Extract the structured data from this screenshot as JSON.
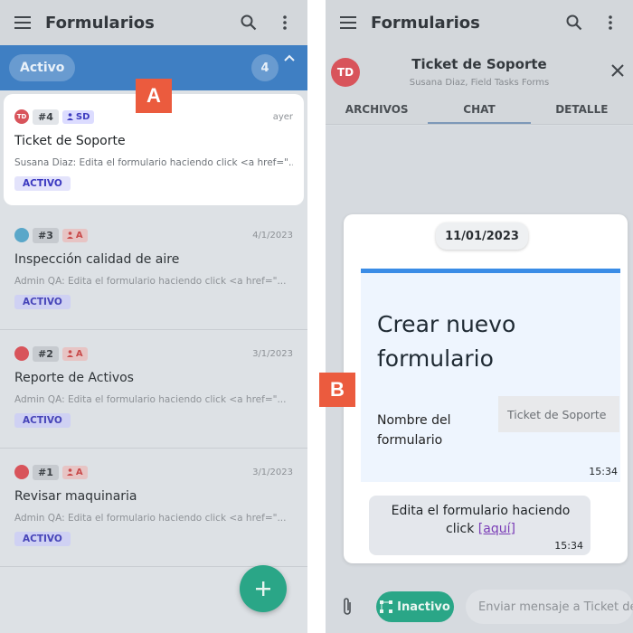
{
  "left_panel": {
    "app_title": "Formularios",
    "section": {
      "label": "Activo",
      "count": "4"
    },
    "tickets": [
      {
        "avatar": "TD",
        "avatar_color": "#d8545b",
        "number": "#4",
        "user": "SD",
        "date": "ayer",
        "title": "Ticket de Soporte",
        "preview": "Susana Diaz: Edita el formulario haciendo click <a href=\"...",
        "status": "ACTIVO"
      },
      {
        "avatar": "",
        "avatar_color": "#5aa7c9",
        "number": "#3",
        "user": "A",
        "date": "4/1/2023",
        "title": "Inspección calidad de aire",
        "preview": "Admin QA: Edita el formulario haciendo click <a href=\"...",
        "status": "ACTIVO"
      },
      {
        "avatar": "",
        "avatar_color": "#d8545b",
        "number": "#2",
        "user": "A",
        "date": "3/1/2023",
        "title": "Reporte de Activos",
        "preview": "Admin QA: Edita el formulario haciendo click <a href=\"...",
        "status": "ACTIVO"
      },
      {
        "avatar": "",
        "avatar_color": "#d8545b",
        "number": "#1",
        "user": "A",
        "date": "3/1/2023",
        "title": "Revisar maquinaria",
        "preview": "Admin QA: Edita el formulario haciendo click <a href=\"...",
        "status": "ACTIVO"
      }
    ]
  },
  "right_panel": {
    "app_title": "Formularios",
    "chat": {
      "avatar": "TD",
      "title": "Ticket de Soporte",
      "subtitle": "Susana Diaz, Field Tasks Forms",
      "tabs": [
        "ARCHIVOS",
        "CHAT",
        "DETALLE"
      ]
    },
    "date_chip": "11/01/2023",
    "form_card": {
      "title": "Crear nuevo formulario",
      "field_label": "Nombre del formulario",
      "field_value": "Ticket de Soporte",
      "time": "15:34"
    },
    "message": {
      "text": "Edita el formulario haciendo click",
      "link": "[aquí]",
      "time": "15:34"
    },
    "bottom": {
      "inactive_label": "Inactivo",
      "input_placeholder": "Enviar mensaje a Ticket de Soporte"
    }
  },
  "markers": {
    "a": "A",
    "b": "B"
  },
  "colors": {
    "accent_blue": "#3f7fc3",
    "green": "#2aa687",
    "marker": "#eb5b3e"
  }
}
